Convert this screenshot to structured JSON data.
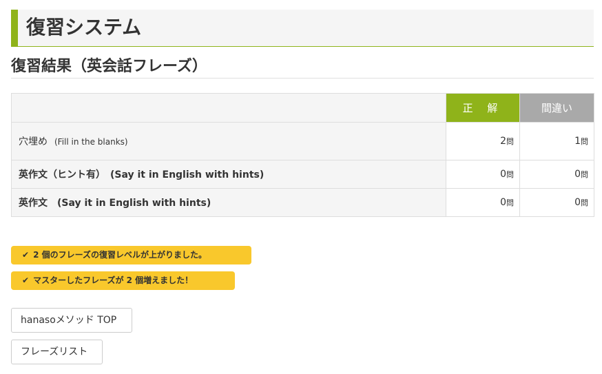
{
  "header": {
    "title": "復習システム"
  },
  "subheading": {
    "title": "復習結果（英会話フレーズ）"
  },
  "table": {
    "columns": {
      "correct": "正 解",
      "wrong": "間違い"
    },
    "rows": [
      {
        "label": "穴埋め",
        "label_en": "(Fill in the blanks)",
        "correct": "2",
        "wrong": "1",
        "unit": "問"
      },
      {
        "label": "英作文（ヒント有）　(Say it in English with hints)",
        "correct": "0",
        "wrong": "0",
        "unit": "問"
      },
      {
        "label": "英作文　(Say it in English with hints)",
        "correct": "0",
        "wrong": "0",
        "unit": "問"
      }
    ]
  },
  "notices": [
    {
      "icon": "check-icon",
      "text": "2 個のフレーズの復習レベルが上がりました。"
    },
    {
      "icon": "check-icon",
      "text": "マスターしたフレーズが 2 個増えました！"
    }
  ],
  "buttons": {
    "top": "hanasoメソッド TOP",
    "phrase_list": "フレーズリスト"
  },
  "colors": {
    "accent": "#8fb31a",
    "wrong_header": "#a9a9a9",
    "notice": "#f9c82c"
  }
}
